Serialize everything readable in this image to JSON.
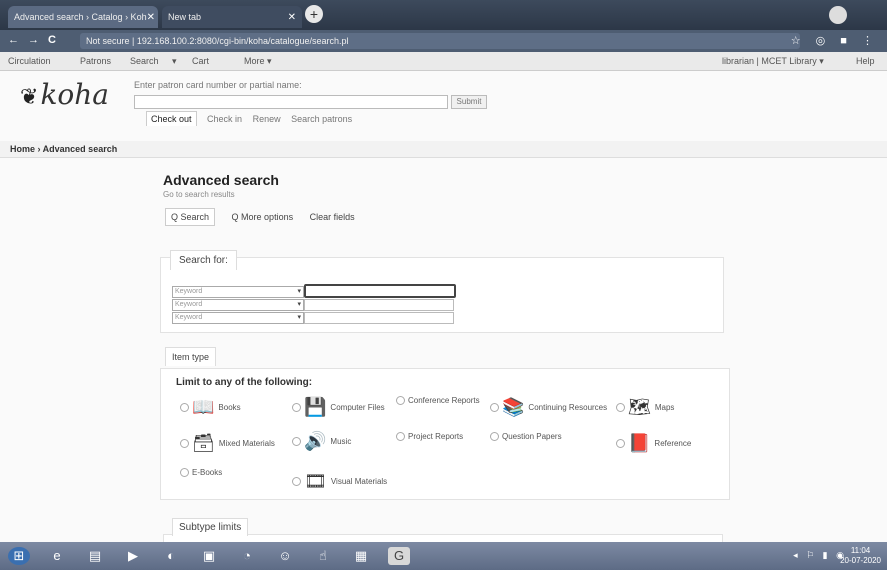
{
  "browser": {
    "tabs": [
      {
        "label": "Advanced search › Catalog › Koh",
        "close": "✕"
      },
      {
        "label": "New tab",
        "close": "✕"
      }
    ],
    "new_tab_symbol": "+",
    "url": "Not secure | 192.168.100.2:8080/cgi-bin/koha/catalogue/search.pl",
    "nav_back": "←",
    "nav_forward": "→",
    "nav_reload": "C",
    "addr_icons": "☆ ◎ ■ ⋮"
  },
  "koha_nav": {
    "items": [
      "Circulation",
      "Patrons",
      "Search",
      "▾",
      "Cart",
      "More ▾"
    ],
    "right_user": "librarian | MCET Library ▾",
    "right_help": "Help"
  },
  "header": {
    "logo_text": "koha",
    "checkout_hint": "Enter patron card number or partial name:",
    "submit": "Submit",
    "tabs": [
      "Check out",
      "Check in",
      "Renew",
      "Search patrons"
    ]
  },
  "breadcrumb": "Home › Advanced search",
  "main": {
    "title": "Advanced search",
    "subtitle": "Go to search results",
    "tools": [
      "Q Search",
      "Q More options",
      "Clear fields"
    ],
    "search_for_label": "Search for:",
    "rows": [
      {
        "index": "Keyword"
      },
      {
        "index": "Keyword"
      },
      {
        "index": "Keyword"
      }
    ],
    "item_type_tab": "Item type",
    "limit_label": "Limit to any of the following:",
    "item_types": [
      {
        "label": "Books",
        "icon": "📖"
      },
      {
        "label": "Computer Files",
        "icon": "💾"
      },
      {
        "label": "Conference Reports",
        "icon": ""
      },
      {
        "label": "Continuing Resources",
        "icon": "📚"
      },
      {
        "label": "Maps",
        "icon": "🗺"
      },
      {
        "label": "Mixed Materials",
        "icon": "🗃"
      },
      {
        "label": "Music",
        "icon": "🔊"
      },
      {
        "label": "Project Reports",
        "icon": ""
      },
      {
        "label": "Question Papers",
        "icon": ""
      },
      {
        "label": "Reference",
        "icon": "📕"
      },
      {
        "label": "E-Books",
        "icon": ""
      },
      {
        "label": "Visual Materials",
        "icon": "🎞"
      }
    ],
    "subtype_label": "Subtype limits"
  },
  "taskbar": {
    "clock_time": "11:04",
    "clock_date": "20-07-2020"
  }
}
